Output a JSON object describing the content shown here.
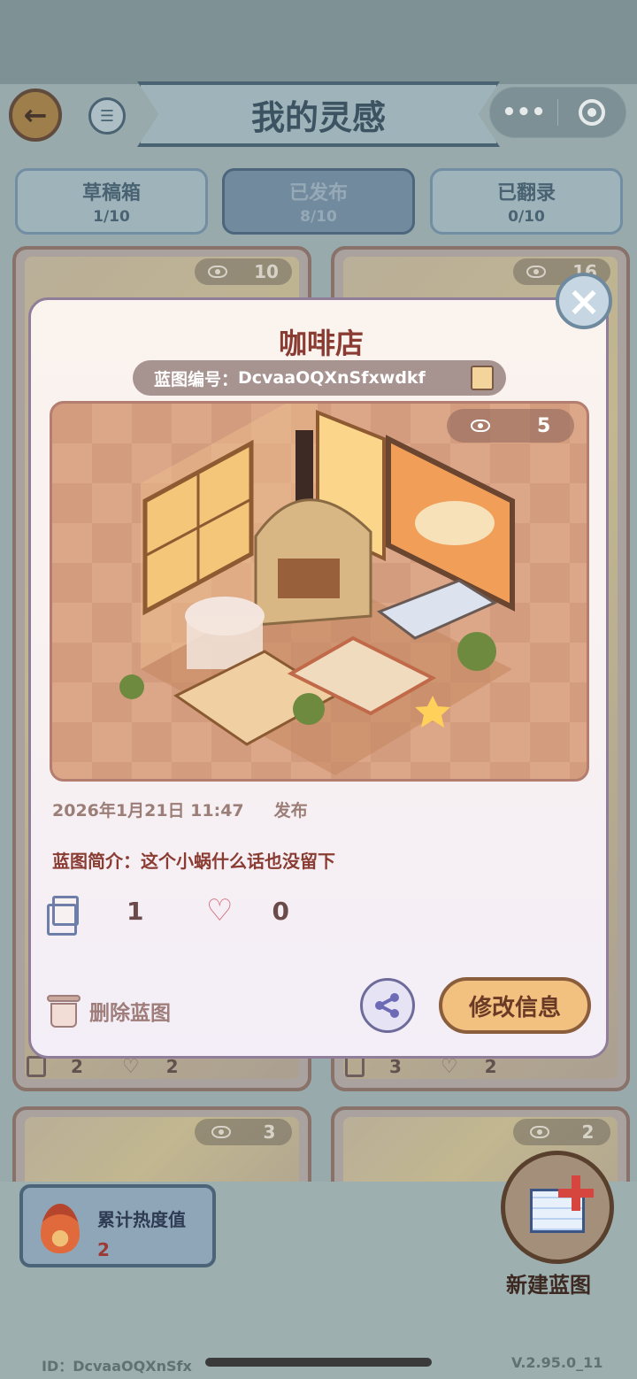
{
  "header": {
    "title": "我的灵感",
    "more_glyph": "•••"
  },
  "tabs": [
    {
      "label": "草稿箱",
      "count": "1/10"
    },
    {
      "label": "已发布",
      "count": "8/10"
    },
    {
      "label": "已翻录",
      "count": "0/10"
    }
  ],
  "cards": [
    {
      "views": "10"
    },
    {
      "views": "16"
    },
    {
      "views": "3"
    },
    {
      "views": "2"
    }
  ],
  "card_stats": [
    {
      "copies": "2",
      "likes": "2"
    },
    {
      "copies": "3",
      "likes": "2"
    }
  ],
  "modal": {
    "title": "咖啡店",
    "code_label": "蓝图编号：",
    "code_value": "DcvaaOQXnSfxwdkf",
    "views": "5",
    "date": "2026年1月21日 11:47",
    "status": "发布",
    "desc_label": "蓝图简介：",
    "desc_value": "这个小蜗什么话也没留下",
    "copies": "1",
    "likes": "0",
    "delete_label": "删除蓝图",
    "edit_label": "修改信息"
  },
  "bottom": {
    "heat_label": "累计热度值",
    "heat_value": "2",
    "new_label": "新建蓝图",
    "user_id": "ID：DcvaaOQXnSfx",
    "version": "V.2.95.0_11"
  },
  "colors": {
    "accent": "#f2c07f",
    "title_red": "#8a3c33",
    "tab_border": "#6f8fa6"
  },
  "icons": [
    "back-arrow-icon",
    "menu-list-icon",
    "more-dots-icon",
    "target-icon",
    "close-icon",
    "copy-icon",
    "eye-icon",
    "heart-icon",
    "trash-icon",
    "share-icon",
    "flame-icon",
    "blueprint-add-icon"
  ]
}
